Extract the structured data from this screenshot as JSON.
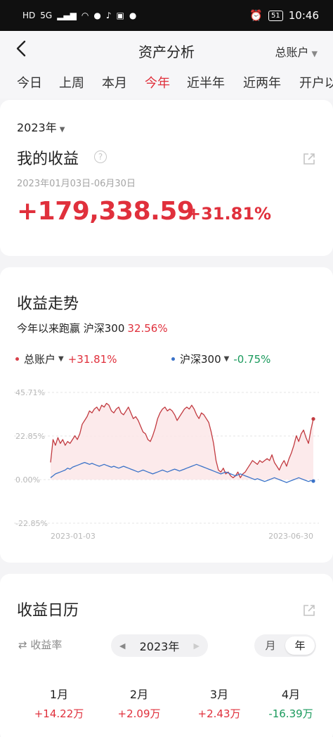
{
  "status_bar": {
    "left_icons": [
      "HD",
      "5G",
      "signal",
      "wifi",
      "chat-bubble",
      "music-note",
      "app-badge",
      "settings-dot"
    ],
    "alarm_icon": "alarm-clock-icon",
    "battery": "51",
    "time": "10:46"
  },
  "header": {
    "title": "资产分析",
    "account": "总账户"
  },
  "tabs": [
    {
      "label": "今日"
    },
    {
      "label": "上周"
    },
    {
      "label": "本月"
    },
    {
      "label": "今年",
      "active": true
    },
    {
      "label": "近半年"
    },
    {
      "label": "近两年"
    },
    {
      "label": "开户以来"
    }
  ],
  "income": {
    "year": "2023年",
    "title": "我的收益",
    "help": "?",
    "date_range": "2023年01月03日-06月30日",
    "amount": "+179,338.59",
    "percent": "+31.81%"
  },
  "trend": {
    "title": "收益走势",
    "beat_text": "今年以来跑赢 沪深300",
    "beat_pct": "32.56%",
    "legend": [
      {
        "name": "总账户",
        "value": "+31.81%",
        "color": "#d8404a"
      },
      {
        "name": "沪深300",
        "value": "-0.75%",
        "color": "#3a72c8"
      }
    ]
  },
  "colors": {
    "accent_red": "#e0303c",
    "up_red": "#e0303c",
    "down_green": "#1a9a5c",
    "series_red": "#c23a40",
    "series_blue": "#3a72c8"
  },
  "chart_data": {
    "type": "line",
    "xlabel": "",
    "ylabel": "",
    "x_ticks": [
      "2023-01-03",
      "2023-06-30"
    ],
    "y_ticks": [
      "45.71%",
      "22.85%",
      "0.00%",
      "-22.85%"
    ],
    "ylim": [
      -22.85,
      45.71
    ],
    "grid": "horizontal dashed",
    "series": [
      {
        "name": "总账户",
        "color": "#c23a40",
        "fill": true,
        "values": [
          9,
          21,
          18,
          22,
          19,
          21,
          18,
          20,
          19,
          21,
          23,
          21,
          24,
          29,
          31,
          33,
          36,
          35,
          37,
          38,
          36,
          39,
          38,
          40,
          39,
          36,
          35,
          37,
          38,
          35,
          34,
          36,
          38,
          35,
          32,
          33,
          31,
          28,
          25,
          24,
          21,
          20,
          23,
          27,
          32,
          35,
          37,
          38,
          36,
          37,
          36,
          34,
          31,
          33,
          35,
          37,
          38,
          37,
          39,
          37,
          34,
          32,
          35,
          34,
          32,
          30,
          25,
          19,
          10,
          5,
          4,
          6,
          3,
          4,
          2,
          1,
          2,
          4,
          1,
          3,
          4,
          6,
          8,
          10,
          9,
          8,
          10,
          9,
          10,
          11,
          10,
          13,
          9,
          7,
          5,
          8,
          10,
          7,
          11,
          14,
          18,
          23,
          20,
          24,
          26,
          22,
          19,
          26,
          31.81
        ]
      },
      {
        "name": "沪深300",
        "color": "#3a72c8",
        "fill": false,
        "values": [
          1,
          2,
          3,
          3.5,
          4,
          4.5,
          5,
          6,
          5.5,
          6.5,
          7,
          7.5,
          8,
          8.5,
          9,
          8.5,
          8,
          8.5,
          8,
          7.5,
          7,
          7.5,
          8,
          7.5,
          7,
          6.5,
          7,
          6.5,
          6,
          6.5,
          7,
          6.5,
          6,
          5.5,
          5,
          4.5,
          4,
          4.5,
          5,
          4.5,
          4,
          3.5,
          3,
          3.5,
          4,
          4.5,
          5,
          4.5,
          4,
          4.5,
          5,
          5.5,
          5,
          4.5,
          5,
          5.5,
          6,
          6.5,
          7,
          7.5,
          8,
          7.5,
          7,
          6.5,
          6,
          5.5,
          5,
          4.5,
          4,
          3.5,
          3,
          3.5,
          4,
          3.5,
          3,
          2.5,
          2,
          2.5,
          3,
          2.5,
          2,
          1.5,
          1,
          0.5,
          0,
          0.5,
          0,
          -0.5,
          -1,
          -0.5,
          0,
          0.5,
          1,
          0.5,
          0,
          -0.5,
          -1,
          -1.5,
          -1,
          -0.5,
          0,
          0.5,
          1,
          0.5,
          0,
          -0.5,
          -1,
          -0.5,
          -0.75
        ]
      }
    ]
  },
  "calendar": {
    "title": "收益日历",
    "rate_toggle": "⇄ 收益率",
    "year": "2023年",
    "segment": [
      "月",
      "年"
    ],
    "months": [
      {
        "name": "1月",
        "value": "+14.22万",
        "up": true
      },
      {
        "name": "2月",
        "value": "+2.09万",
        "up": true
      },
      {
        "name": "3月",
        "value": "+2.43万",
        "up": true
      },
      {
        "name": "4月",
        "value": "-16.39万",
        "up": false
      }
    ]
  }
}
